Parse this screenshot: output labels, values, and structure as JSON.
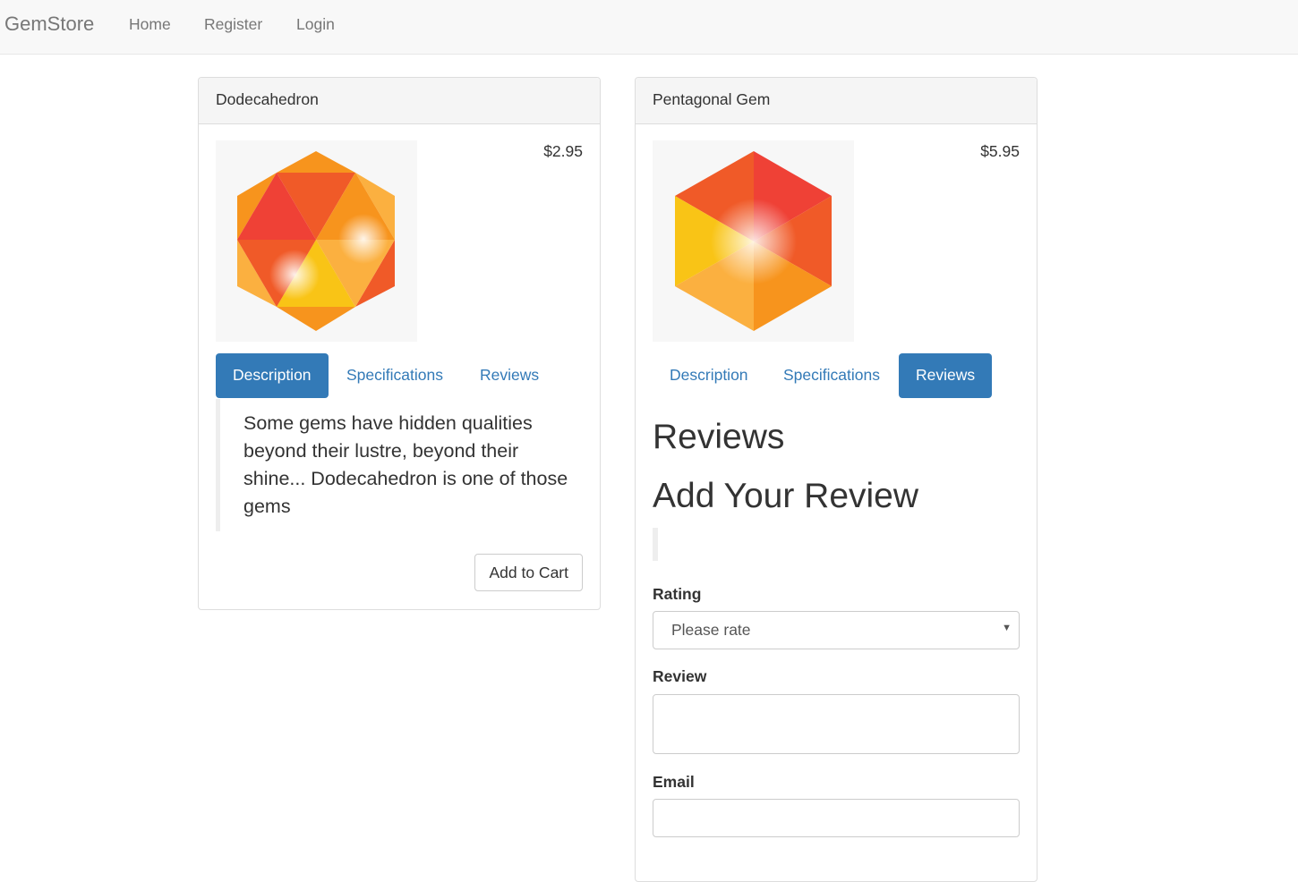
{
  "navbar": {
    "brand": "GemStore",
    "links": [
      "Home",
      "Register",
      "Login"
    ]
  },
  "products": [
    {
      "name": "Dodecahedron",
      "price": "$2.95",
      "tabs": [
        "Description",
        "Specifications",
        "Reviews"
      ],
      "active_tab": "Description",
      "description": "Some gems have hidden qualities beyond their lustre, beyond their shine... Dodecahedron is one of those gems",
      "add_to_cart": "Add to Cart"
    },
    {
      "name": "Pentagonal Gem",
      "price": "$5.95",
      "tabs": [
        "Description",
        "Specifications",
        "Reviews"
      ],
      "active_tab": "Reviews",
      "reviews_heading": "Reviews",
      "add_review_heading": "Add Your Review",
      "form": {
        "rating_label": "Rating",
        "rating_value": "Please rate",
        "review_label": "Review",
        "review_value": "",
        "email_label": "Email",
        "email_value": ""
      }
    }
  ],
  "colors": {
    "accent": "#337ab7",
    "gem_red": "#ef4136",
    "gem_orange": "#f05a28",
    "gem_amber": "#f7941d",
    "gem_light": "#fbb040",
    "gem_yellow": "#f9c416"
  }
}
